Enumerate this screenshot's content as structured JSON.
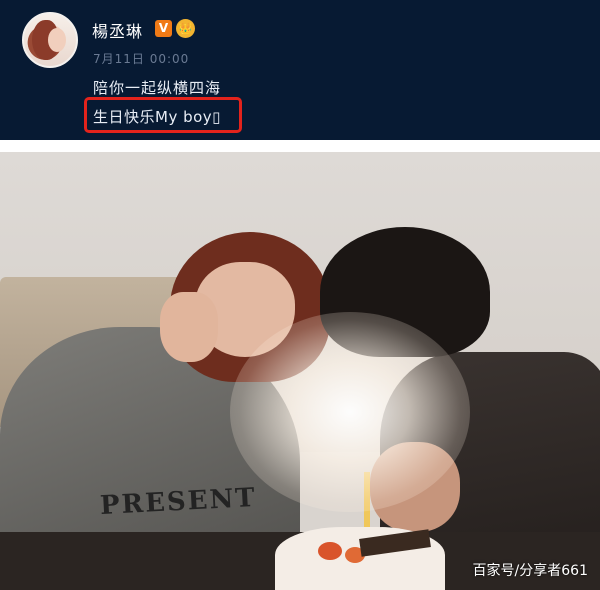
{
  "post": {
    "username": "楊丞琳",
    "verified_badge": "V",
    "crown_badge": "👑",
    "timestamp": "7月11日 00:00",
    "text_line1": "陪你一起纵横四海",
    "text_line2": "生日快乐My boy▯"
  },
  "photo": {
    "sweater_print": "PRESENT",
    "watermark": "百家号/分享者661"
  },
  "colors": {
    "header_bg": "#071a33",
    "highlight_border": "#e3231c",
    "verified_orange": "#f07a16"
  }
}
